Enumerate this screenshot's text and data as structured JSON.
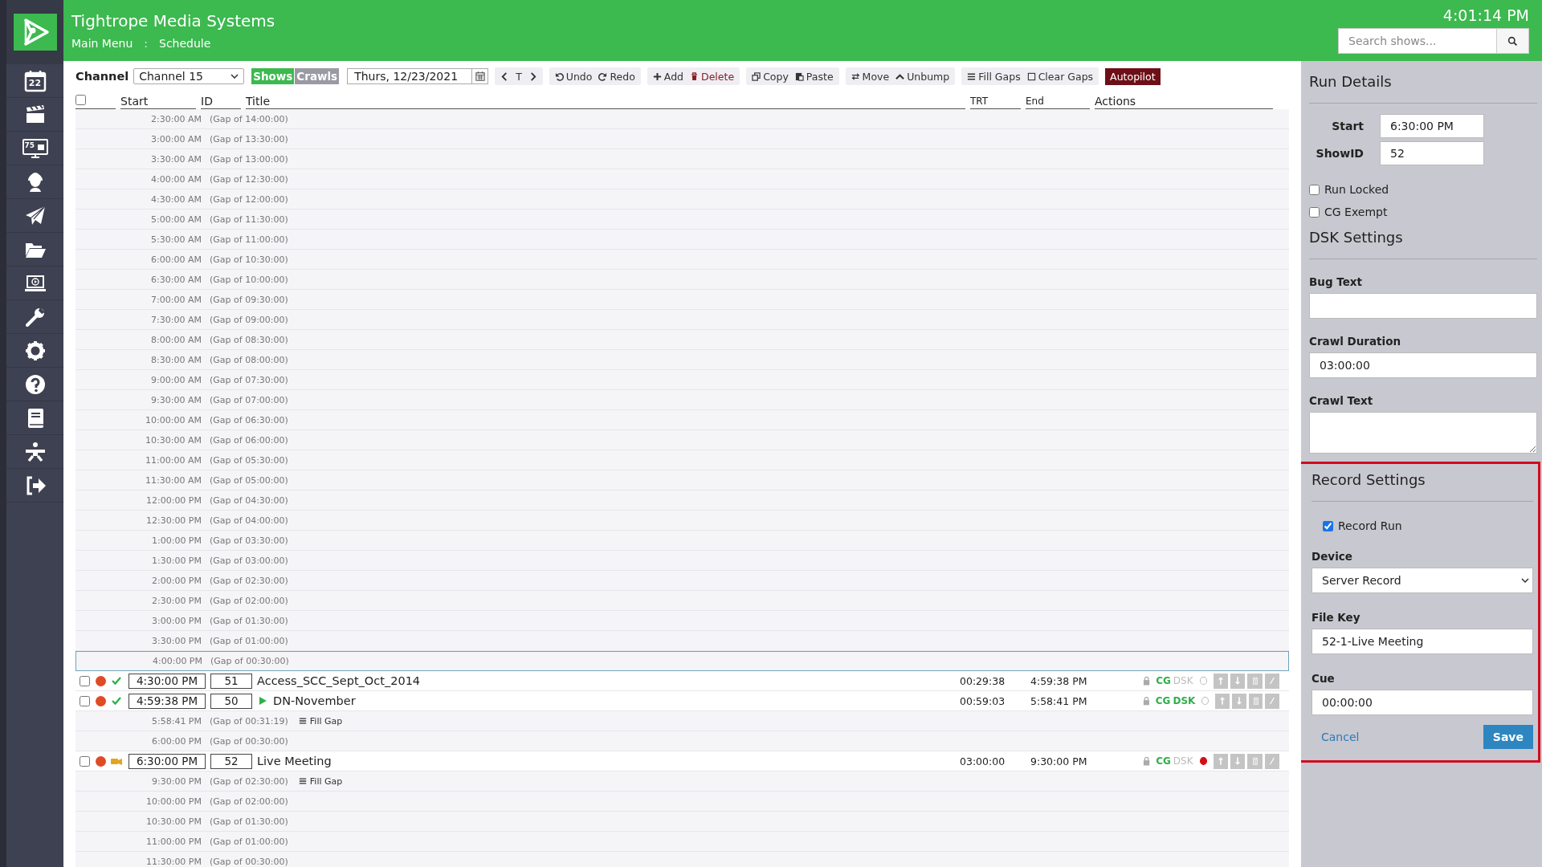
{
  "header": {
    "title": "Tightrope Media Systems",
    "breadcrumb": [
      "Main Menu",
      "Schedule"
    ],
    "separator": ":",
    "clock": "4:01:14 PM",
    "search": {
      "placeholder": "Search shows..."
    }
  },
  "sidebar": {
    "items": [
      {
        "kind": "calendar",
        "text": "22"
      },
      {
        "kind": "clapper"
      },
      {
        "kind": "monitor",
        "text": "75"
      },
      {
        "kind": "headset"
      },
      {
        "kind": "plane"
      },
      {
        "kind": "folder"
      },
      {
        "kind": "laptop"
      },
      {
        "kind": "wrench"
      },
      {
        "kind": "gear"
      },
      {
        "kind": "help"
      },
      {
        "kind": "book"
      },
      {
        "kind": "figure"
      },
      {
        "kind": "logout"
      }
    ]
  },
  "toolbar": {
    "channel_label": "Channel",
    "channel": "Channel 15",
    "views": [
      {
        "label": "Shows",
        "selected": true
      },
      {
        "label": "Crawls",
        "selected": false
      }
    ],
    "date": "Thurs, 12/23/2021",
    "today": "T",
    "groups": [
      [
        {
          "label": "Undo"
        },
        {
          "label": "Redo"
        }
      ],
      [
        {
          "label": "Add"
        },
        {
          "label": "Delete"
        }
      ],
      [
        {
          "label": "Copy"
        },
        {
          "label": "Paste"
        }
      ],
      [
        {
          "label": "Move"
        },
        {
          "label": "Unbump"
        }
      ],
      [
        {
          "label": "Fill Gaps"
        },
        {
          "label": "Clear Gaps"
        }
      ]
    ],
    "autopilot": "Autopilot"
  },
  "select_all": false,
  "columns": [
    "Start",
    "ID",
    "Title",
    "TRT",
    "End",
    "Actions"
  ],
  "rows": [
    {
      "kind": "gap",
      "start": "2:30:00 AM",
      "gap": "(Gap of 14:00:00)",
      "selected": false
    },
    {
      "kind": "gap",
      "start": "3:00:00 AM",
      "gap": "(Gap of 13:30:00)",
      "selected": false
    },
    {
      "kind": "gap",
      "start": "3:30:00 AM",
      "gap": "(Gap of 13:00:00)",
      "selected": false
    },
    {
      "kind": "gap",
      "start": "4:00:00 AM",
      "gap": "(Gap of 12:30:00)",
      "selected": false
    },
    {
      "kind": "gap",
      "start": "4:30:00 AM",
      "gap": "(Gap of 12:00:00)",
      "selected": false
    },
    {
      "kind": "gap",
      "start": "5:00:00 AM",
      "gap": "(Gap of 11:30:00)",
      "selected": false
    },
    {
      "kind": "gap",
      "start": "5:30:00 AM",
      "gap": "(Gap of 11:00:00)",
      "selected": false
    },
    {
      "kind": "gap",
      "start": "6:00:00 AM",
      "gap": "(Gap of 10:30:00)",
      "selected": false
    },
    {
      "kind": "gap",
      "start": "6:30:00 AM",
      "gap": "(Gap of 10:00:00)",
      "selected": false
    },
    {
      "kind": "gap",
      "start": "7:00:00 AM",
      "gap": "(Gap of 09:30:00)",
      "selected": false
    },
    {
      "kind": "gap",
      "start": "7:30:00 AM",
      "gap": "(Gap of 09:00:00)",
      "selected": false
    },
    {
      "kind": "gap",
      "start": "8:00:00 AM",
      "gap": "(Gap of 08:30:00)",
      "selected": false
    },
    {
      "kind": "gap",
      "start": "8:30:00 AM",
      "gap": "(Gap of 08:00:00)",
      "selected": false
    },
    {
      "kind": "gap",
      "start": "9:00:00 AM",
      "gap": "(Gap of 07:30:00)",
      "selected": false
    },
    {
      "kind": "gap",
      "start": "9:30:00 AM",
      "gap": "(Gap of 07:00:00)",
      "selected": false
    },
    {
      "kind": "gap",
      "start": "10:00:00 AM",
      "gap": "(Gap of 06:30:00)",
      "selected": false
    },
    {
      "kind": "gap",
      "start": "10:30:00 AM",
      "gap": "(Gap of 06:00:00)",
      "selected": false
    },
    {
      "kind": "gap",
      "start": "11:00:00 AM",
      "gap": "(Gap of 05:30:00)",
      "selected": false
    },
    {
      "kind": "gap",
      "start": "11:30:00 AM",
      "gap": "(Gap of 05:00:00)",
      "selected": false
    },
    {
      "kind": "gap",
      "start": "12:00:00 PM",
      "gap": "(Gap of 04:30:00)",
      "selected": false
    },
    {
      "kind": "gap",
      "start": "12:30:00 PM",
      "gap": "(Gap of 04:00:00)",
      "selected": false
    },
    {
      "kind": "gap",
      "start": "1:00:00 PM",
      "gap": "(Gap of 03:30:00)",
      "selected": false
    },
    {
      "kind": "gap",
      "start": "1:30:00 PM",
      "gap": "(Gap of 03:00:00)",
      "selected": false
    },
    {
      "kind": "gap",
      "start": "2:00:00 PM",
      "gap": "(Gap of 02:30:00)",
      "selected": false
    },
    {
      "kind": "gap",
      "start": "2:30:00 PM",
      "gap": "(Gap of 02:00:00)",
      "selected": false
    },
    {
      "kind": "gap",
      "start": "3:00:00 PM",
      "gap": "(Gap of 01:30:00)",
      "selected": false
    },
    {
      "kind": "gap",
      "start": "3:30:00 PM",
      "gap": "(Gap of 01:00:00)",
      "selected": false
    },
    {
      "kind": "gap",
      "start": "4:00:00 PM",
      "gap": "(Gap of 00:30:00)",
      "selected": true
    },
    {
      "kind": "show",
      "checked": false,
      "record": true,
      "live": false,
      "start": "4:30:00 PM",
      "id": "51",
      "title": "Access_SCC_Sept_Oct_2014",
      "playing": false,
      "trt": "00:29:38",
      "end": "4:59:38 PM",
      "cg": "CG",
      "dsk": "DSK",
      "dsk_on": false,
      "recording": false,
      "selected": false
    },
    {
      "kind": "show",
      "checked": false,
      "record": true,
      "live": false,
      "start": "4:59:38 PM",
      "id": "50",
      "title": "DN-November",
      "playing": true,
      "trt": "00:59:03",
      "end": "5:58:41 PM",
      "cg": "CG",
      "dsk": "DSK",
      "dsk_on": true,
      "recording": false,
      "selected": false
    },
    {
      "kind": "gap",
      "start": "5:58:41 PM",
      "gap": "(Gap of 00:31:19)",
      "fill": "Fill Gap",
      "selected": false
    },
    {
      "kind": "gap",
      "start": "6:00:00 PM",
      "gap": "(Gap of 00:30:00)",
      "selected": false
    },
    {
      "kind": "show",
      "checked": false,
      "record": true,
      "live": true,
      "start": "6:30:00 PM",
      "id": "52",
      "title": "Live Meeting",
      "playing": false,
      "trt": "03:00:00",
      "end": "9:30:00 PM",
      "cg": "CG",
      "dsk": "DSK",
      "dsk_on": false,
      "recording": true,
      "selected": false
    },
    {
      "kind": "gap",
      "start": "9:30:00 PM",
      "gap": "(Gap of 02:30:00)",
      "fill": "Fill Gap",
      "selected": false
    },
    {
      "kind": "gap",
      "start": "10:00:00 PM",
      "gap": "(Gap of 02:00:00)",
      "selected": false
    },
    {
      "kind": "gap",
      "start": "10:30:00 PM",
      "gap": "(Gap of 01:30:00)",
      "selected": false
    },
    {
      "kind": "gap",
      "start": "11:00:00 PM",
      "gap": "(Gap of 01:00:00)",
      "selected": false
    },
    {
      "kind": "gap",
      "start": "11:30:00 PM",
      "gap": "(Gap of 00:30:00)",
      "selected": false
    }
  ],
  "details": {
    "title": "Run Details",
    "start_label": "Start",
    "start": "6:30:00 PM",
    "showid_label": "ShowID",
    "showid": "52",
    "checks": [
      {
        "label": "Run Locked",
        "checked": false
      },
      {
        "label": "CG Exempt",
        "checked": false
      }
    ],
    "dsk_title": "DSK Settings",
    "fields": [
      {
        "label": "Bug Text",
        "kind": "input"
      },
      {
        "label": "Crawl Duration",
        "kind": "input",
        "value": "03:00:00"
      },
      {
        "label": "Crawl Text",
        "kind": "textarea"
      }
    ]
  },
  "record": {
    "title": "Record Settings",
    "highlighted": true,
    "record_run": {
      "label": "Record Run",
      "checked": true
    },
    "fields": [
      {
        "label": "Device",
        "kind": "select",
        "value": "Server Record"
      },
      {
        "label": "File Key",
        "kind": "input",
        "value": "52-1-Live Meeting"
      },
      {
        "label": "Cue",
        "kind": "input",
        "value": "00:00:00"
      }
    ],
    "cancel": "Cancel",
    "save": "Save"
  }
}
